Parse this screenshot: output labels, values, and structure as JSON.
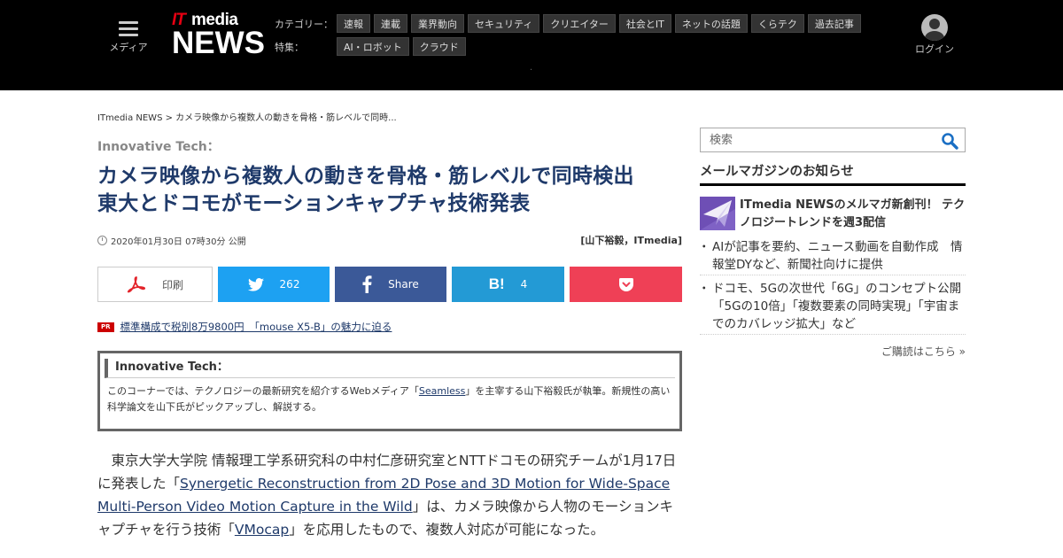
{
  "header": {
    "menu_label": "メディア",
    "logo": {
      "it": "IT",
      "media": "media",
      "news": "NEWS"
    },
    "category_caption": "カテゴリー：",
    "categories": [
      "速報",
      "連載",
      "業界動向",
      "セキュリティ",
      "クリエイター",
      "社会とIT",
      "ネットの話題",
      "くらテク",
      "過去記事"
    ],
    "feature_caption": "特集：",
    "features": [
      "AI・ロボット",
      "クラウド"
    ],
    "login_label": "ログイン"
  },
  "article": {
    "breadcrumb": "ITmedia NEWS > カメラ映像から複数人の動きを骨格・筋レベルで同時...",
    "series": "Innovative Tech：",
    "title_line1": "カメラ映像から複数人の動きを骨格・筋レベルで同時検出",
    "title_line2": "東大とドコモがモーションキャプチャ技術発表",
    "date": "2020年01月30日 07時30分 公開",
    "author": "[山下裕毅，ITmedia]",
    "share": {
      "print_label": "印刷",
      "twitter_count": "262",
      "facebook_label": "Share",
      "hatena_count": "4"
    },
    "pr": {
      "badge": "PR",
      "text": "標準構成で税別8万9800円　「mouse X5-B」の魅力に迫る"
    },
    "infobox": {
      "title": "Innovative Tech：",
      "text_before": "このコーナーでは、テクノロジーの最新研究を紹介するWebメディア「",
      "link": "Seamless",
      "text_after": "」を主宰する山下裕毅氏が執筆。新規性の高い科学論文を山下氏がピックアップし、解説する。"
    },
    "body": {
      "p1": "　東京大学大学院 情報理工学系研究科の中村仁彦研究室とNTTドコモの研究チームが1月17日に発表した「",
      "link1": "Synergetic Reconstruction from 2D Pose and 3D Motion for Wide-Space Multi-Person Video Motion Capture in the Wild",
      "p2": "」は、カメラ映像から人物のモーションキャプチャを行う技術「",
      "link2": "VMocap",
      "p3": "」を応用したもので、複数人対応が可能になった。"
    }
  },
  "sidebar": {
    "search_placeholder": "検索",
    "mailmag_heading": "メールマガジンのお知らせ",
    "mailmag_title": "ITmedia NEWSのメルマガ新創刊！ テクノロジートレンドを週3配信",
    "items": [
      "AIが記事を要約、ニュース動画を自動作成　情報堂DYなど、新聞社向けに提供",
      "ドコモ、5Gの次世代「6G」のコンセプト公開　「5Gの10倍」「複数要素の同時実現」「宇宙までのカバレッジ拡大」など"
    ],
    "more_label": "ご購読はこちら »"
  },
  "colors": {
    "title": "#1f3a6a",
    "twitter": "#1da1f2",
    "facebook": "#3b5998",
    "hatena": "#239ad5",
    "pocket": "#ef4056",
    "logo_red": "#e60012"
  }
}
